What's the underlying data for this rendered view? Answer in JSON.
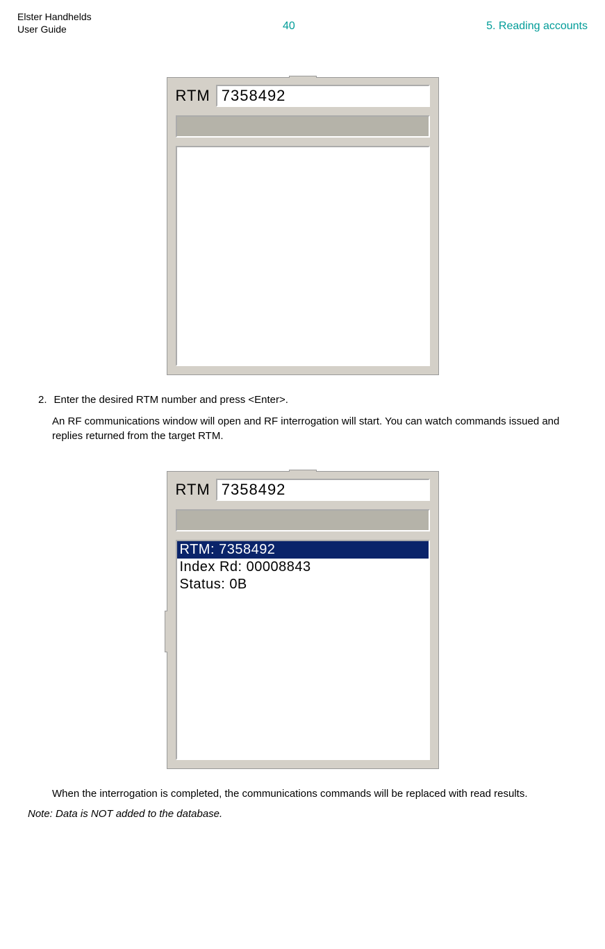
{
  "header": {
    "title_line1": "Elster Handhelds",
    "title_line2": "User Guide",
    "page_number": "40",
    "section": "5. Reading accounts"
  },
  "screenshot1": {
    "rtm_label": "RTM",
    "rtm_value": "7358492",
    "list_lines": []
  },
  "step": {
    "number": "2.",
    "instruction": "Enter the desired RTM number and press <Enter>.",
    "followup": "An RF communications window will open and RF interrogation will start. You can watch commands issued and replies returned from the target RTM."
  },
  "screenshot2": {
    "rtm_label": "RTM",
    "rtm_value": "7358492",
    "list_lines": [
      {
        "text": "RTM: 7358492",
        "selected": true
      },
      {
        "text": "Index Rd: 00008843",
        "selected": false
      },
      {
        "text": "Status: 0B",
        "selected": false
      }
    ]
  },
  "conclusion": "When the interrogation is completed, the communications commands will be replaced with read results.",
  "note": "Note: Data is NOT added to the database."
}
